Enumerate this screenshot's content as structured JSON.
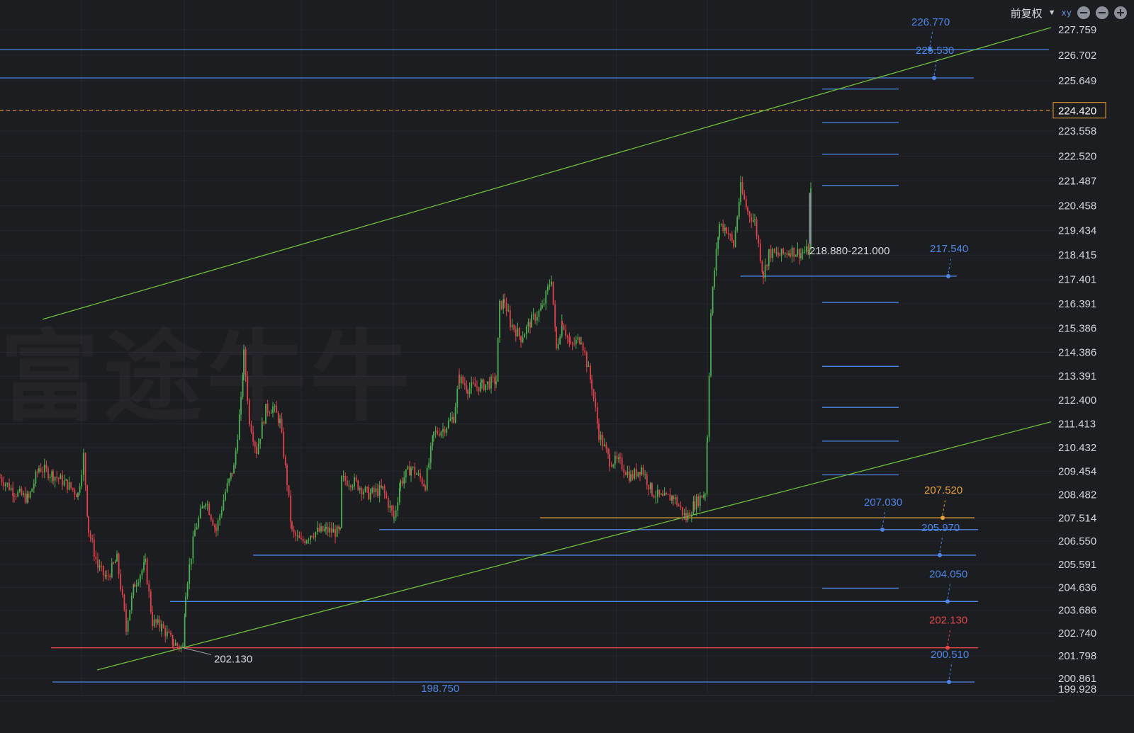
{
  "toolbar": {
    "adjust_label": "前复权",
    "chevron_icon": "chevron-down-icon",
    "xy_icon": "axis-scale-icon",
    "xy_glyph": "xy",
    "btn1_icon": "minus-circle-icon",
    "btn2_icon": "minus-circle-icon",
    "btn3_icon": "plus-circle-icon"
  },
  "watermark": "富途牛牛",
  "colors": {
    "background": "#1c1d21",
    "up": "#4caf50",
    "down": "#e0424b",
    "level_blue": "#4d86e6",
    "level_orange": "#e8a33c",
    "level_red": "#e04848",
    "trend_green": "#6fbf3a",
    "current_price": "#f0a030"
  },
  "chart_data": {
    "type": "candlestick",
    "ylim": [
      199.5,
      228.2
    ],
    "y_ticks": [
      "227.759",
      "226.702",
      "225.649",
      "224.420",
      "223.558",
      "222.520",
      "221.487",
      "220.458",
      "219.434",
      "218.415",
      "217.401",
      "216.391",
      "215.386",
      "214.386",
      "213.391",
      "212.400",
      "211.413",
      "210.432",
      "209.454",
      "208.482",
      "207.514",
      "206.550",
      "205.591",
      "204.636",
      "203.686",
      "202.740",
      "201.798",
      "200.861",
      "199.928"
    ],
    "current_price": "224.420",
    "price_path": [
      [
        0,
        209.2
      ],
      [
        20,
        208.6
      ],
      [
        40,
        208.3
      ],
      [
        55,
        209.6
      ],
      [
        75,
        209.3
      ],
      [
        95,
        208.9
      ],
      [
        110,
        208.5
      ],
      [
        118,
        210.1
      ],
      [
        125,
        207.0
      ],
      [
        138,
        205.5
      ],
      [
        150,
        205.0
      ],
      [
        165,
        205.8
      ],
      [
        178,
        203.0
      ],
      [
        190,
        204.8
      ],
      [
        205,
        205.6
      ],
      [
        215,
        203.2
      ],
      [
        228,
        203.0
      ],
      [
        245,
        202.3
      ],
      [
        258,
        202.13
      ],
      [
        262,
        204.5
      ],
      [
        275,
        207.0
      ],
      [
        290,
        208.3
      ],
      [
        305,
        207.0
      ],
      [
        318,
        208.6
      ],
      [
        330,
        209.6
      ],
      [
        340,
        212.3
      ],
      [
        344,
        214.3
      ],
      [
        352,
        211.6
      ],
      [
        362,
        210.3
      ],
      [
        375,
        212.0
      ],
      [
        385,
        212.1
      ],
      [
        395,
        211.5
      ],
      [
        405,
        209.0
      ],
      [
        412,
        206.9
      ],
      [
        425,
        206.5
      ],
      [
        440,
        206.9
      ],
      [
        460,
        207.0
      ],
      [
        480,
        206.9
      ],
      [
        482,
        209.1
      ],
      [
        500,
        209.0
      ],
      [
        520,
        208.5
      ],
      [
        540,
        208.7
      ],
      [
        556,
        207.5
      ],
      [
        565,
        209.0
      ],
      [
        580,
        209.6
      ],
      [
        600,
        208.9
      ],
      [
        612,
        211.0
      ],
      [
        625,
        211.2
      ],
      [
        640,
        211.7
      ],
      [
        648,
        213.3
      ],
      [
        660,
        212.9
      ],
      [
        680,
        213.0
      ],
      [
        700,
        213.2
      ],
      [
        705,
        216.3
      ],
      [
        712,
        216.5
      ],
      [
        720,
        215.6
      ],
      [
        735,
        215.0
      ],
      [
        750,
        215.7
      ],
      [
        765,
        216.2
      ],
      [
        778,
        217.5
      ],
      [
        785,
        214.5
      ],
      [
        793,
        215.7
      ],
      [
        805,
        214.6
      ],
      [
        820,
        215.0
      ],
      [
        835,
        213.0
      ],
      [
        845,
        211.0
      ],
      [
        860,
        209.9
      ],
      [
        875,
        209.8
      ],
      [
        890,
        209.2
      ],
      [
        905,
        209.6
      ],
      [
        920,
        208.6
      ],
      [
        935,
        208.3
      ],
      [
        950,
        208.4
      ],
      [
        968,
        207.5
      ],
      [
        980,
        208.1
      ],
      [
        995,
        208.6
      ],
      [
        998,
        211.0
      ],
      [
        1003,
        216.0
      ],
      [
        1008,
        217.8
      ],
      [
        1015,
        219.7
      ],
      [
        1025,
        219.5
      ],
      [
        1035,
        218.8
      ],
      [
        1045,
        221.2
      ],
      [
        1055,
        220.2
      ],
      [
        1065,
        219.8
      ],
      [
        1077,
        217.6
      ],
      [
        1085,
        218.5
      ],
      [
        1100,
        218.4
      ],
      [
        1115,
        218.6
      ],
      [
        1130,
        218.5
      ],
      [
        1142,
        218.6
      ],
      [
        1144,
        221.0
      ],
      [
        1146,
        224.3
      ]
    ],
    "price_levels": [
      {
        "value": 226.77,
        "label": "226.770",
        "color": "blue",
        "x1": 0,
        "x2": 1480,
        "marker_x": 1312
      },
      {
        "value": 225.53,
        "label": "225.530",
        "color": "blue",
        "x1": 0,
        "x2": 1374,
        "marker_x": 1318
      },
      {
        "value": 217.54,
        "label": "217.540",
        "color": "blue",
        "x1": 1045,
        "x2": 1350,
        "marker_x": 1338
      },
      {
        "value": 207.52,
        "label": "207.520",
        "color": "orange",
        "x1": 762,
        "x2": 1375,
        "marker_x": 1330
      },
      {
        "value": 207.03,
        "label": "207.030",
        "color": "blue",
        "x1": 535,
        "x2": 1380,
        "marker_x": 1245
      },
      {
        "value": 205.97,
        "label": "205.970",
        "color": "blue",
        "x1": 357,
        "x2": 1377,
        "marker_x": 1326
      },
      {
        "value": 204.05,
        "label": "204.050",
        "color": "blue",
        "x1": 240,
        "x2": 1380,
        "marker_x": 1337
      },
      {
        "value": 202.13,
        "label": "202.130",
        "color": "red",
        "x1": 72,
        "x2": 1380,
        "marker_x": 1337
      },
      {
        "value": 200.51,
        "label": "200.510",
        "color": "blue",
        "x1": 74,
        "x2": 1375,
        "marker_x": 1339
      },
      {
        "value": 198.75,
        "label": "198.750",
        "color": "blue",
        "x1": 74,
        "x2": 1375,
        "marker_x": 1339,
        "label_x": 622
      }
    ],
    "short_levels": [
      225.3,
      223.9,
      222.6,
      221.3,
      216.45,
      213.8,
      212.1,
      210.7,
      209.3,
      204.6
    ],
    "trend_lines": [
      {
        "from": [
          60,
          215.75
        ],
        "to": [
          1483,
          227.85
        ]
      },
      {
        "from": [
          137,
          201.21
        ],
        "to": [
          1483,
          211.5
        ]
      }
    ],
    "annotations": [
      {
        "text": "202.130",
        "x": 302,
        "value": 201.67,
        "leader_from": [
          258,
          202.13
        ]
      },
      {
        "text": "218.880-221.000",
        "x": 1142,
        "value": 218.6,
        "bar_x": 1143,
        "bar_from": 218.88,
        "bar_to": 221.0
      }
    ]
  }
}
